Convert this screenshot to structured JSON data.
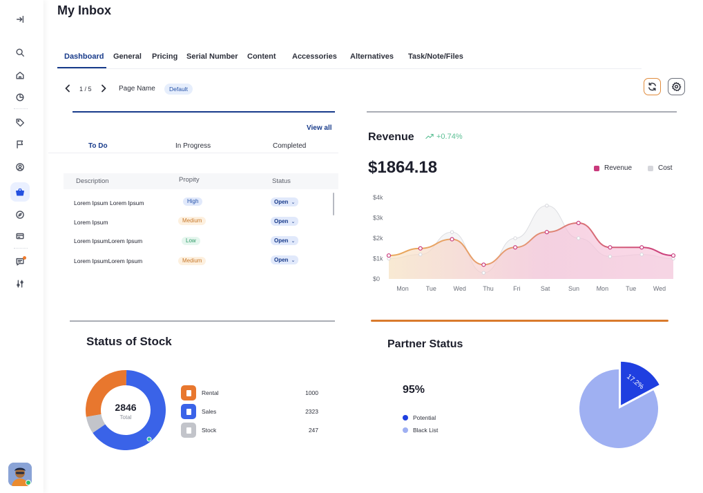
{
  "page": {
    "title": "My Inbox"
  },
  "sidebar": {
    "icons": [
      "expand-icon",
      "search-icon",
      "home-icon",
      "pie-chart-icon",
      "tag-icon",
      "flag-icon",
      "user-circle-icon",
      "basket-icon",
      "compass-icon",
      "card-icon",
      "message-icon",
      "sliders-icon"
    ],
    "active": "basket-icon"
  },
  "tabs": [
    "Dashboard",
    "General",
    "Pricing",
    "Serial Number",
    "Content",
    "Accessories",
    "Alternatives",
    "Task/Note/Files"
  ],
  "pager": {
    "text": "1 / 5",
    "page_name_label": "Page Name",
    "page_name_value": "Default"
  },
  "tasks": {
    "view_all": "View all",
    "tabs": [
      "To Do",
      "In Progress",
      "Completed"
    ],
    "columns": [
      "Description",
      "Propity",
      "Status"
    ],
    "rows": [
      {
        "description": "Lorem Ipsum Lorem Ipsum",
        "priority": "High",
        "status": "Open"
      },
      {
        "description": "Lorem Ipsum",
        "priority": "Medium",
        "status": "Open"
      },
      {
        "description": "Lorem IpsumLorem Ipsum",
        "priority": "Low",
        "status": "Open"
      },
      {
        "description": "Lorem IpsumLorem Ipsum",
        "priority": "Medium",
        "status": "Open"
      }
    ]
  },
  "revenue": {
    "title": "Revenue",
    "change": "+0.74%",
    "amount": "$1864.18",
    "legend": [
      "Revenue",
      "Cost"
    ]
  },
  "stock": {
    "title": "Status of Stock",
    "total_value": "2846",
    "total_label": "Total",
    "items": [
      {
        "label": "Rental",
        "value": "1000"
      },
      {
        "label": "Sales",
        "value": "2323"
      },
      {
        "label": "Stock",
        "value": "247"
      }
    ]
  },
  "partner": {
    "title": "Partner Status",
    "percent": "95%",
    "legend": [
      "Potential",
      "Black List"
    ],
    "slice_label": "17.2%"
  },
  "colors": {
    "primary": "#173a8a",
    "revenue": "#c93a7c",
    "cost": "#d5d6db",
    "rental": "#e8772e",
    "sales": "#3a63e8",
    "stock": "#c2c4ca",
    "potential": "#1f3fe0",
    "black_list": "#9fb0f2"
  },
  "chart_data": [
    {
      "type": "area",
      "x": [
        "Mon",
        "Tue",
        "Wed",
        "Thu",
        "Fri",
        "Sat",
        "Sun",
        "Mon",
        "Tue",
        "Wed"
      ],
      "yticks": [
        "$0",
        "$1k",
        "$2k",
        "$3k",
        "$4k"
      ],
      "ylim": [
        0,
        4000
      ],
      "series": [
        {
          "name": "Revenue",
          "values": [
            1150,
            1500,
            1950,
            700,
            1550,
            2300,
            2750,
            1550,
            1550,
            1150
          ]
        },
        {
          "name": "Cost",
          "values": [
            1000,
            1200,
            2300,
            300,
            2000,
            3600,
            2000,
            1100,
            1200,
            1000
          ]
        }
      ],
      "grid": false
    },
    {
      "type": "pie",
      "title": "Status of Stock",
      "style": "donut",
      "categories": [
        "Rental",
        "Sales",
        "Stock"
      ],
      "values": [
        1000,
        2323,
        247
      ]
    },
    {
      "type": "pie",
      "title": "Partner Status",
      "categories": [
        "Potential",
        "Black List"
      ],
      "values": [
        17.2,
        82.8
      ]
    }
  ]
}
